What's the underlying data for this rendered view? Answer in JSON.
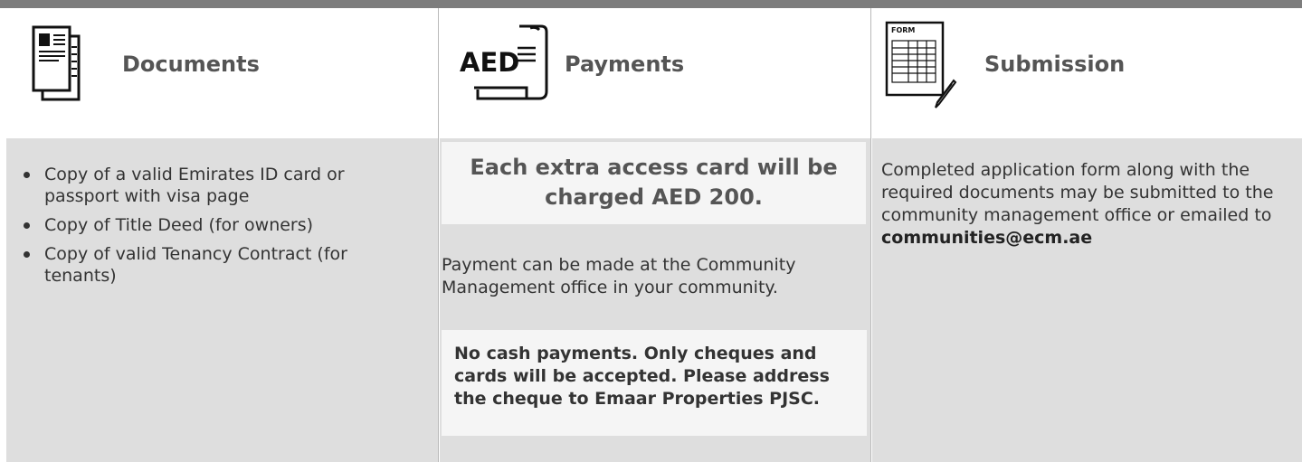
{
  "columns": {
    "documents": {
      "title": "Documents",
      "icon": "documents-icon",
      "items": [
        "Copy of a valid Emirates ID card or passport with visa page",
        "Copy of Title Deed (for owners)",
        "Copy of valid Tenancy Contract (for tenants)"
      ]
    },
    "payments": {
      "title": "Payments",
      "icon": "aed-receipt-icon",
      "icon_text": "AED",
      "callout": "Each extra access card will be charged AED 200.",
      "text": "Payment can be made at the Community Management office in your community.",
      "note": "No cash payments. Only cheques and cards will be accepted. Please address the cheque to Emaar Properties PJSC."
    },
    "submission": {
      "title": "Submission",
      "icon": "form-pencil-icon",
      "icon_text": "FORM",
      "text": "Completed application form along with the required documents may be submitted to the community management office or emailed to",
      "email": "communities@ecm.ae"
    }
  },
  "colors": {
    "topbar": "#7d7d7d",
    "panel": "#dedede",
    "callout": "#f5f5f5",
    "title": "#555555",
    "text": "#333333"
  }
}
